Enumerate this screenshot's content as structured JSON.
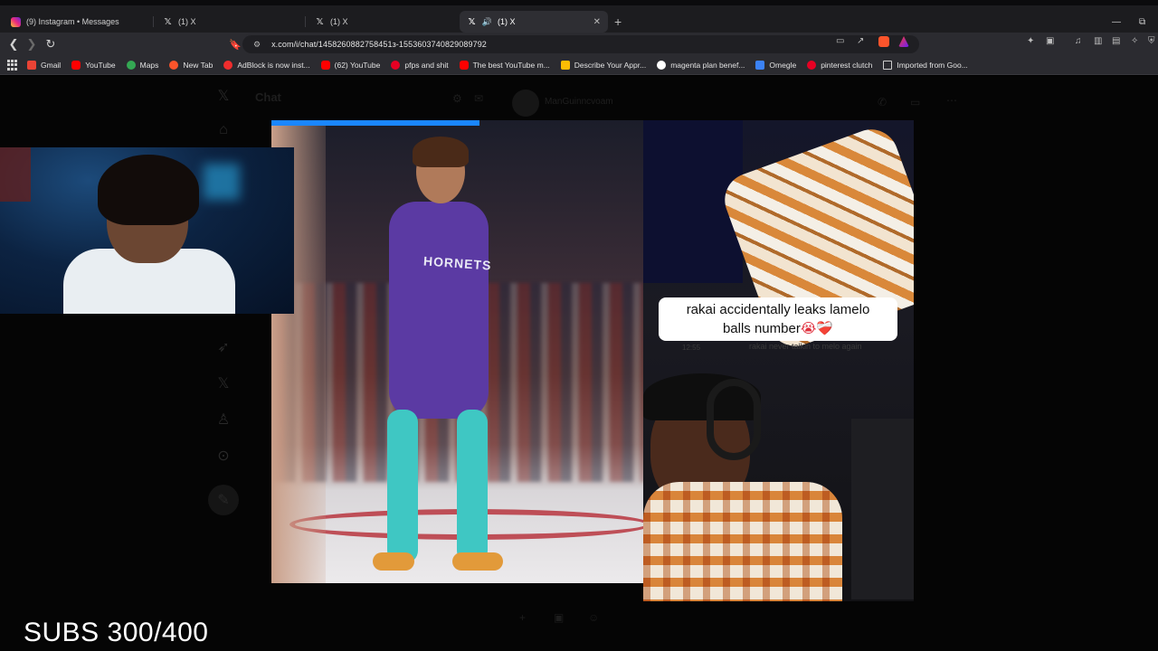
{
  "tabs": [
    {
      "title": "(9) Instagram • Messages",
      "icon": "instagram-icon",
      "active": false
    },
    {
      "title": "(1) X",
      "icon": "x-logo-icon",
      "active": false
    },
    {
      "title": "(1) X",
      "icon": "x-logo-icon",
      "active": false
    },
    {
      "title": "(1) X",
      "icon": "x-logo-icon",
      "active": true
    }
  ],
  "address_bar": {
    "url": "x.com/i/chat/1458260882758451з-1553603740829089792"
  },
  "bookmarks": [
    {
      "label": "Gmail",
      "color": "#ea4335"
    },
    {
      "label": "YouTube",
      "color": "#ff0000"
    },
    {
      "label": "Maps",
      "color": "#34a853"
    },
    {
      "label": "New Tab",
      "color": "#fb542b"
    },
    {
      "label": "AdBlock is now inst...",
      "color": "#f02d2d"
    },
    {
      "label": "(62) YouTube",
      "color": "#ff0000"
    },
    {
      "label": "pfps and shit",
      "color": "#e60023"
    },
    {
      "label": "The best YouTube m...",
      "color": "#ff0000"
    },
    {
      "label": "Describe Your Appr...",
      "color": "#fbbc04"
    },
    {
      "label": "magenta plan benef...",
      "color": "#ffffff"
    },
    {
      "label": "Omegle",
      "color": "#3b82f6"
    },
    {
      "label": "pinterest clutch",
      "color": "#e60023"
    },
    {
      "label": "Imported from Goo...",
      "color": "#cfcfcf"
    }
  ],
  "chat": {
    "title": "Chat",
    "username": "ManGuinncvoam"
  },
  "video": {
    "caption_line1": "rakai accidentally leaks lamelo",
    "caption_line2": "balls number",
    "caption_emoji": "😭❤️‍🩹",
    "dm_preview": "rakai never talkin to melo again",
    "dm_time": "12:55",
    "jersey_text": "HORNETS"
  },
  "overlay": {
    "subs_text": "SUBS 300/400"
  }
}
